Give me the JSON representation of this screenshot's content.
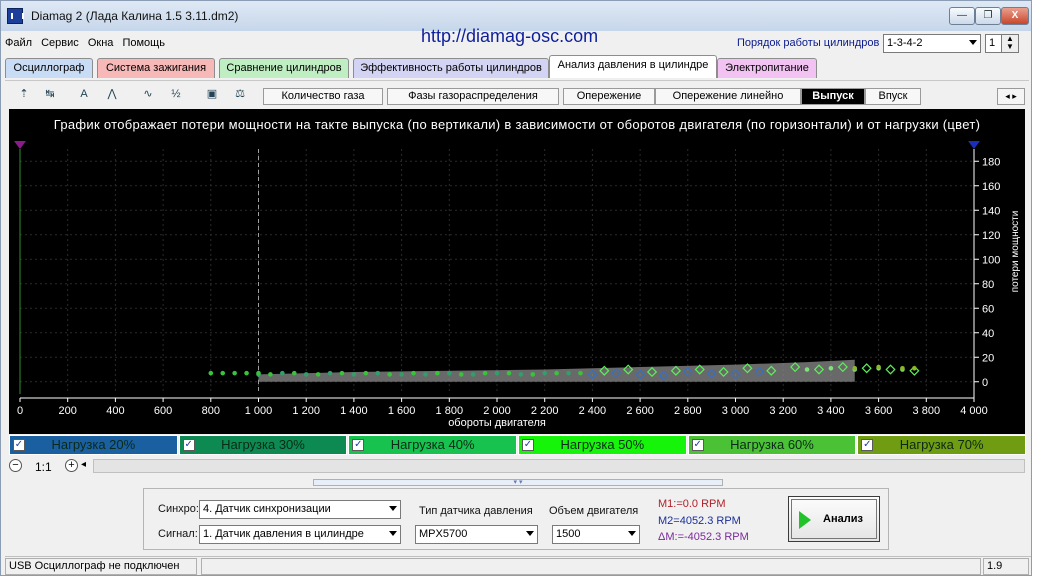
{
  "window": {
    "title": "Diamag 2 (Лада Калина 1.5 3.11.dm2)",
    "controls": {
      "minimize": "—",
      "maximize": "❐",
      "close": "X"
    }
  },
  "menu": [
    "Файл",
    "Сервис",
    "Окна",
    "Помощь"
  ],
  "url": "http://diamag-osc.com",
  "cylinder_order": {
    "label": "Порядок работы цилиндров",
    "value": "1-3-4-2",
    "cylinder": "1"
  },
  "main_tabs": [
    {
      "label": "Осциллограф",
      "color": "#c9dcf5"
    },
    {
      "label": "Система зажигания",
      "color": "#f7b8b8"
    },
    {
      "label": "Сравнение цилиндров",
      "color": "#bfeec2"
    },
    {
      "label": "Эффективность работы цилиндров",
      "color": "#d3d3f4"
    },
    {
      "label": "Анализ давления в цилиндре",
      "color": "#ffffff",
      "active": true
    },
    {
      "label": "Электропитание",
      "color": "#f2c2f2"
    }
  ],
  "toolbar_icons": [
    "cursor-tool-icon",
    "auto-scale-icon",
    "auto-measure-icon",
    "peaks-icon",
    "curve-icon",
    "algorithm-icon",
    "save-icon",
    "balance-icon"
  ],
  "toolbar_icon_glyphs": {
    "tool1": "⇡",
    "tool2": "↹",
    "tool3": "A",
    "tool4": "⋀",
    "tool5": "∿",
    "tool6": "½",
    "tool7": "▣",
    "tool8": "⚖"
  },
  "sub_tabs": [
    {
      "label": "Количество газа"
    },
    {
      "label": "Фазы газораспределения"
    },
    {
      "label": "Опережение"
    },
    {
      "label": "Опережение линейно"
    },
    {
      "label": "Выпуск",
      "active": true
    },
    {
      "label": "Впуск"
    }
  ],
  "sub_nav": {
    "prev": "◂",
    "next": "▸"
  },
  "plot": {
    "description": "График отображает потери мощности на такте выпуска (по вертикали) в зависимости от оборотов двигателя (по горизонтали) и от нагрузки (цвет)"
  },
  "chart_data": {
    "type": "scatter",
    "xlabel": "обороты двигателя",
    "ylabel": "потери мощности",
    "xlim": [
      0,
      4000
    ],
    "ylim": [
      -10,
      190
    ],
    "x_ticks": [
      "0",
      "200",
      "400",
      "600",
      "800",
      "1 000",
      "1 200",
      "1 400",
      "1 600",
      "1 800",
      "2 000",
      "2 200",
      "2 400",
      "2 600",
      "2 800",
      "3 000",
      "3 200",
      "3 400",
      "3 600",
      "3 800",
      "4 000"
    ],
    "y_ticks": [
      "0",
      "20",
      "40",
      "60",
      "80",
      "100",
      "120",
      "140",
      "160",
      "180"
    ],
    "grid": true,
    "cursors": {
      "m1_rpm": 1000
    },
    "band": {
      "x": [
        1000,
        1400,
        1800,
        2200,
        2600,
        3000,
        3300,
        3500
      ],
      "lower": [
        0,
        0,
        0,
        0,
        0,
        0,
        0,
        0
      ],
      "upper": [
        6,
        8,
        9,
        10,
        12,
        14,
        16,
        18
      ]
    },
    "series": [
      {
        "name": "Нагрузка 20%",
        "color": "#3a6fbf",
        "x": [
          2400,
          2500,
          2600,
          2700,
          2800,
          2900,
          3000,
          3100
        ],
        "y": [
          6,
          7,
          6,
          5,
          8,
          7,
          6,
          8
        ]
      },
      {
        "name": "Нагрузка 30%",
        "color": "#2fa06a",
        "x": [
          1000,
          1100,
          1200,
          1300,
          1400,
          1500,
          1600,
          1700,
          1800,
          1900,
          2000,
          2100,
          2200,
          2300
        ],
        "y": [
          6,
          7,
          6,
          7,
          6,
          7,
          6,
          6,
          7,
          6,
          7,
          6,
          7,
          7
        ]
      },
      {
        "name": "Нагрузка 40%",
        "color": "#37c43a",
        "x": [
          800,
          850,
          900,
          950,
          1000,
          1050,
          1150,
          1250,
          1350,
          1450,
          1550,
          1650,
          1750,
          1850,
          1950,
          2050,
          2150,
          2250,
          2350
        ],
        "y": [
          7,
          7,
          7,
          7,
          7,
          6,
          7,
          6,
          7,
          7,
          6,
          7,
          7,
          6,
          7,
          7,
          6,
          7,
          7
        ]
      },
      {
        "name": "Нагрузка 50%",
        "color": "#5cf05a",
        "x": [
          2450,
          2550,
          2650,
          2750,
          2850,
          2950,
          3050,
          3150,
          3250,
          3350,
          3450,
          3550,
          3650,
          3750
        ],
        "y": [
          9,
          10,
          8,
          9,
          10,
          8,
          11,
          9,
          12,
          10,
          12,
          11,
          10,
          9
        ]
      },
      {
        "name": "Нагрузка 60%",
        "color": "#80e07a",
        "x": [
          3300,
          3400,
          3500,
          3600,
          3700
        ],
        "y": [
          10,
          11,
          10,
          11,
          10
        ]
      },
      {
        "name": "Нагрузка 70%",
        "color": "#8ab82a",
        "x": [
          3500,
          3600,
          3700,
          3750
        ],
        "y": [
          11,
          12,
          11,
          11
        ]
      }
    ]
  },
  "loads": [
    {
      "label": "Нагрузка 20%",
      "color": "#1a5f9f"
    },
    {
      "label": "Нагрузка 30%",
      "color": "#0c8a52"
    },
    {
      "label": "Нагрузка 40%",
      "color": "#18c24e"
    },
    {
      "label": "Нагрузка 50%",
      "color": "#16f40a"
    },
    {
      "label": "Нагрузка 60%",
      "color": "#4bc235"
    },
    {
      "label": "Нагрузка 70%",
      "color": "#6f9c10"
    }
  ],
  "zoom": {
    "label": "1:1",
    "minus": "−",
    "plus": "+",
    "left": "◂",
    "collapse_handle": "▾ ▾"
  },
  "controls": {
    "sync_label": "Синхро:",
    "sync_value": "4.  Датчик синхронизации",
    "signal_label": "Сигнал:",
    "signal_value": "1.  Датчик давления в цилиндре",
    "sensor_type_label": "Тип датчика давления",
    "sensor_type_value": "MPX5700",
    "engine_volume_label": "Объем двигателя",
    "engine_volume_value": "1500",
    "m1": "M1:=0.0 RPM",
    "m2": "M2=4052.3 RPM",
    "dm": "ΔM:=-4052.3 RPM",
    "analyze_label": "Анализ"
  },
  "status": {
    "connection": "USB Осциллограф не подключен",
    "version": "1.9"
  }
}
